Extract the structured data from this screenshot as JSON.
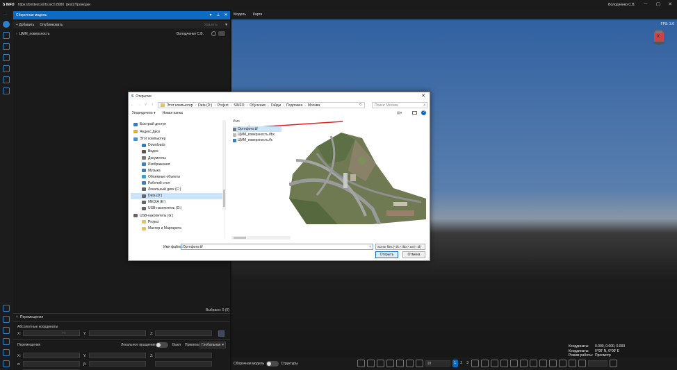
{
  "app": {
    "logo": "S INFO",
    "url": "https://bimtest.sinfo.tech:8080",
    "project": "[test] Проекции",
    "user": "Володченко С.В."
  },
  "panel": {
    "title": "Сборочная модель",
    "add_label": "Добавить",
    "publish_label": "Опубликовать",
    "delete_label": "Удалить",
    "tree_item": "ЦММ_поверхность",
    "tree_item_user": "Володченко С.В.",
    "selected": "Выбрано: 0 (0)",
    "move_section": "Перемещения",
    "abs_coords": "Абсолютные координаты",
    "move_label": "Перемещения",
    "local_rotation": "Локальное вращение",
    "toggle_off": "Выкл",
    "binding_label": "Привязка",
    "binding_value": "Глобальная",
    "x": "X:",
    "y": "Y:",
    "z": "Z:",
    "alpha": "α:",
    "beta": "β:",
    "s": "S:"
  },
  "viewport": {
    "tab_model": "Модель",
    "tab_map": "Карта",
    "fps": "FPS: 3.0",
    "gizmo_label": "X",
    "coords_label": "Координаты:",
    "coords_value1": "0.000, 0.000, 0.000",
    "coords_value2": "0°00' N, 0°00' E",
    "mode_label": "Режим работы:",
    "mode_value": "Просмотр",
    "assembly_toggle": "Сборочная модель",
    "structures_label": "Структуры",
    "page_size": "10",
    "pages": [
      "1",
      "2",
      "3"
    ]
  },
  "dialog": {
    "title": "Открытие",
    "breadcrumb": [
      "Этот компьютер",
      "Data (D:)",
      "Project",
      "SINFO",
      "Обучение",
      "Гайды",
      "Подложка",
      "Москва"
    ],
    "search_placeholder": "Поиск: Москва",
    "organize": "Упорядочить",
    "new_folder": "Новая папка",
    "nav": [
      {
        "label": "Быстрый доступ",
        "level": 1,
        "color": "#2f7fc8"
      },
      {
        "label": "Яндекс.Диск",
        "level": 1,
        "color": "#e0b020"
      },
      {
        "label": "Этот компьютер",
        "level": 1,
        "color": "#4a90d0"
      },
      {
        "label": "Downloads",
        "level": 2,
        "color": "#2f7fc8"
      },
      {
        "label": "Видео",
        "level": 2,
        "color": "#555"
      },
      {
        "label": "Документы",
        "level": 2,
        "color": "#777"
      },
      {
        "label": "Изображения",
        "level": 2,
        "color": "#3a7fc0"
      },
      {
        "label": "Музыка",
        "level": 2,
        "color": "#3a7fc0"
      },
      {
        "label": "Объемные объекты",
        "level": 2,
        "color": "#3aa0d0"
      },
      {
        "label": "Рабочий стол",
        "level": 2,
        "color": "#3a7fc0"
      },
      {
        "label": "Локальный диск (C:)",
        "level": 2,
        "color": "#666"
      },
      {
        "label": "Data (D:)",
        "level": 2,
        "color": "#666"
      },
      {
        "label": "MEDIA (E:)",
        "level": 2,
        "color": "#666"
      },
      {
        "label": "USB-накопитель (G:)",
        "level": 2,
        "color": "#666"
      },
      {
        "label": "USB-накопитель (G:)",
        "level": 1,
        "color": "#666"
      },
      {
        "label": "Project",
        "level": 2,
        "color": "#e8c060"
      },
      {
        "label": "Мастер и Маргарита",
        "level": 2,
        "color": "#e8c060"
      }
    ],
    "nav_selected_index": 11,
    "column_name": "Имя",
    "files": [
      {
        "name": "Ортофото.tif",
        "color": "#777"
      },
      {
        "name": "ЦММ_поверхность.ifbx",
        "color": "#bbb"
      },
      {
        "name": "ЦММ_поверхность.ifc",
        "color": "#3a7fc0"
      }
    ],
    "filename_label": "Имя файла:",
    "filename_value": "Ортофото.tif",
    "filetype": "Scene files (*.ifc;*.ifbx;*.xml;*.tif)",
    "open_label": "Открыть",
    "cancel_label": "Отмена"
  }
}
